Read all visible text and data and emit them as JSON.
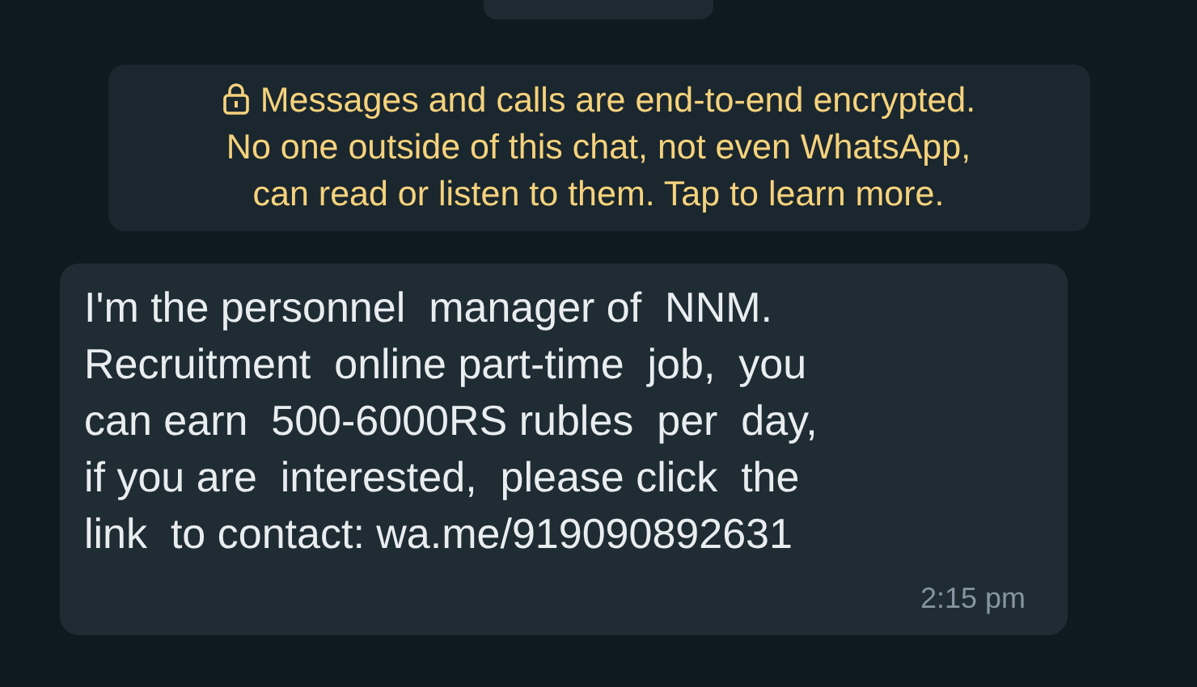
{
  "encryption_notice": {
    "text": "Messages and calls are end-to-end encrypted.\nNo one outside of this chat, not even WhatsApp,\ncan read or listen to them. Tap to learn more."
  },
  "messages": [
    {
      "text": "I'm the personnel  manager of  NNM.\nRecruitment  online part-time  job,  you\ncan earn  500-6000RS rubles  per  day,\nif you are  interested,  please click  the\nlink  to contact: wa.me/919090892631",
      "time": "2:15 pm"
    }
  ]
}
